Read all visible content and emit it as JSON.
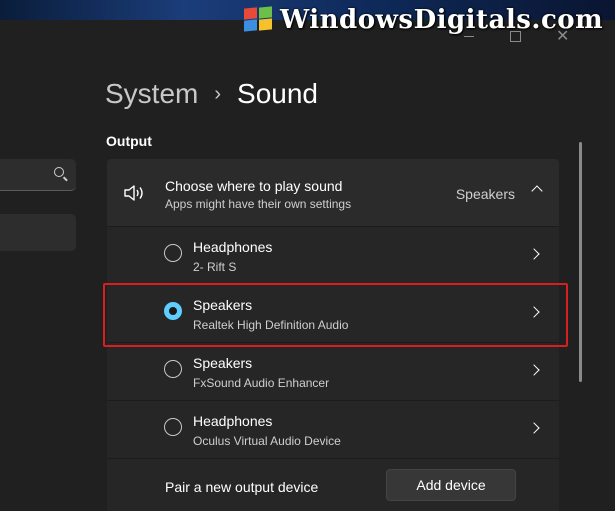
{
  "watermark": {
    "text": "WindowsDigitals.com"
  },
  "breadcrumb": {
    "parent": "System",
    "current": "Sound",
    "separator": "›"
  },
  "output": {
    "section_label": "Output",
    "card_title": "Choose where to play sound",
    "card_subtitle": "Apps might have their own settings",
    "selected_value": "Speakers",
    "devices": [
      {
        "name": "Headphones",
        "description": "2- Rift S",
        "selected": false
      },
      {
        "name": "Speakers",
        "description": "Realtek High Definition Audio",
        "selected": true
      },
      {
        "name": "Speakers",
        "description": "FxSound Audio Enhancer",
        "selected": false
      },
      {
        "name": "Headphones",
        "description": "Oculus Virtual Audio Device",
        "selected": false
      }
    ],
    "pair_label": "Pair a new output device",
    "add_button": "Add device"
  },
  "colors": {
    "accent": "#60cdff",
    "highlight": "#d81e1e",
    "background": "#202020"
  }
}
